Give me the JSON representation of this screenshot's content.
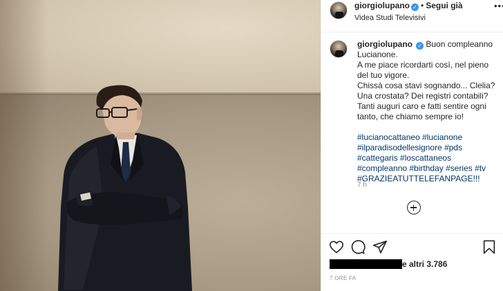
{
  "post": {
    "username": "giorgiolupano",
    "follow_label": "Segui già",
    "location": "Videa Studi Televisivi",
    "more_icon": "more-options-icon"
  },
  "caption": {
    "username": "giorgiolupano",
    "lines": [
      "Buon compleanno",
      "Lucianone.",
      "A me piace ricordarti così, nel pieno",
      "del tuo vigore.",
      "Chissà cosa stavi sognando... Clelia?",
      "Una crostata? Dei registri contabili?",
      "Tanti auguri caro e fatti sentire ogni",
      "tanto, che chiamo sempre io!"
    ],
    "hashtag_lines": [
      "#lucianocattaneo #lucianone",
      "#ilparadisodellesignore #pds",
      "#cattegaris #loscattaneos",
      "#compleanno #birthday #series #tv",
      "#GRAZIEATUTTELEFANPAGE!!!"
    ],
    "time": "7 h"
  },
  "actions": {
    "like_icon": "heart-icon",
    "comment_icon": "comment-icon",
    "share_icon": "share-icon",
    "save_icon": "bookmark-icon",
    "likes_text": "e altri 3.786",
    "date": "7 ORE FA"
  },
  "colors": {
    "hashtag": "#00376b",
    "verified": "#3897f0",
    "muted": "#8e8e8e",
    "border": "#efefef"
  }
}
